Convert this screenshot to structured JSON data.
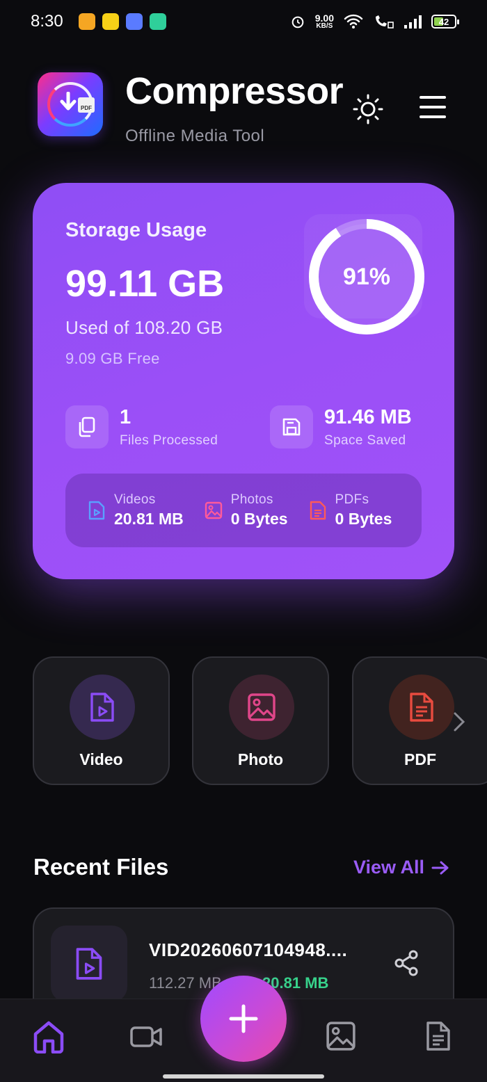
{
  "status_bar": {
    "time": "8:30",
    "net_speed_value": "9.00",
    "net_speed_unit": "KB/S",
    "battery": "42",
    "app_icons": [
      "#f5a623",
      "#f7d117",
      "#5a7bff",
      "#2fcf9a"
    ]
  },
  "header": {
    "title": "Compressor",
    "subtitle": "Offline Media Tool"
  },
  "storage": {
    "label": "Storage Usage",
    "used": "99.11 GB",
    "used_of": "Used of 108.20 GB",
    "free": "9.09 GB Free",
    "percent_label": "91%",
    "percent_value": 0.91,
    "files_processed_count": "1",
    "files_processed_label": "Files Processed",
    "space_saved_value": "91.46 MB",
    "space_saved_label": "Space Saved",
    "breakdown": [
      {
        "label": "Videos",
        "value": "20.81 MB",
        "color": "#5aa0ff"
      },
      {
        "label": "Photos",
        "value": "0 Bytes",
        "color": "#ff5a9a"
      },
      {
        "label": "PDFs",
        "value": "0 Bytes",
        "color": "#ff5a5a"
      }
    ]
  },
  "tools": [
    {
      "label": "Video",
      "color": "#8b4cf6",
      "bg": "#35294f"
    },
    {
      "label": "Photo",
      "color": "#e0468a",
      "bg": "#3e2330"
    },
    {
      "label": "PDF",
      "color": "#e84b3f",
      "bg": "#42231f"
    }
  ],
  "recent": {
    "title": "Recent Files",
    "view_all": "View All",
    "files": [
      {
        "name": "VID20260607104948....",
        "original_size": "112.27 MB",
        "new_size": "20.81 MB"
      }
    ]
  },
  "nav": {
    "active": "home",
    "accent": "#8b4cf6"
  }
}
